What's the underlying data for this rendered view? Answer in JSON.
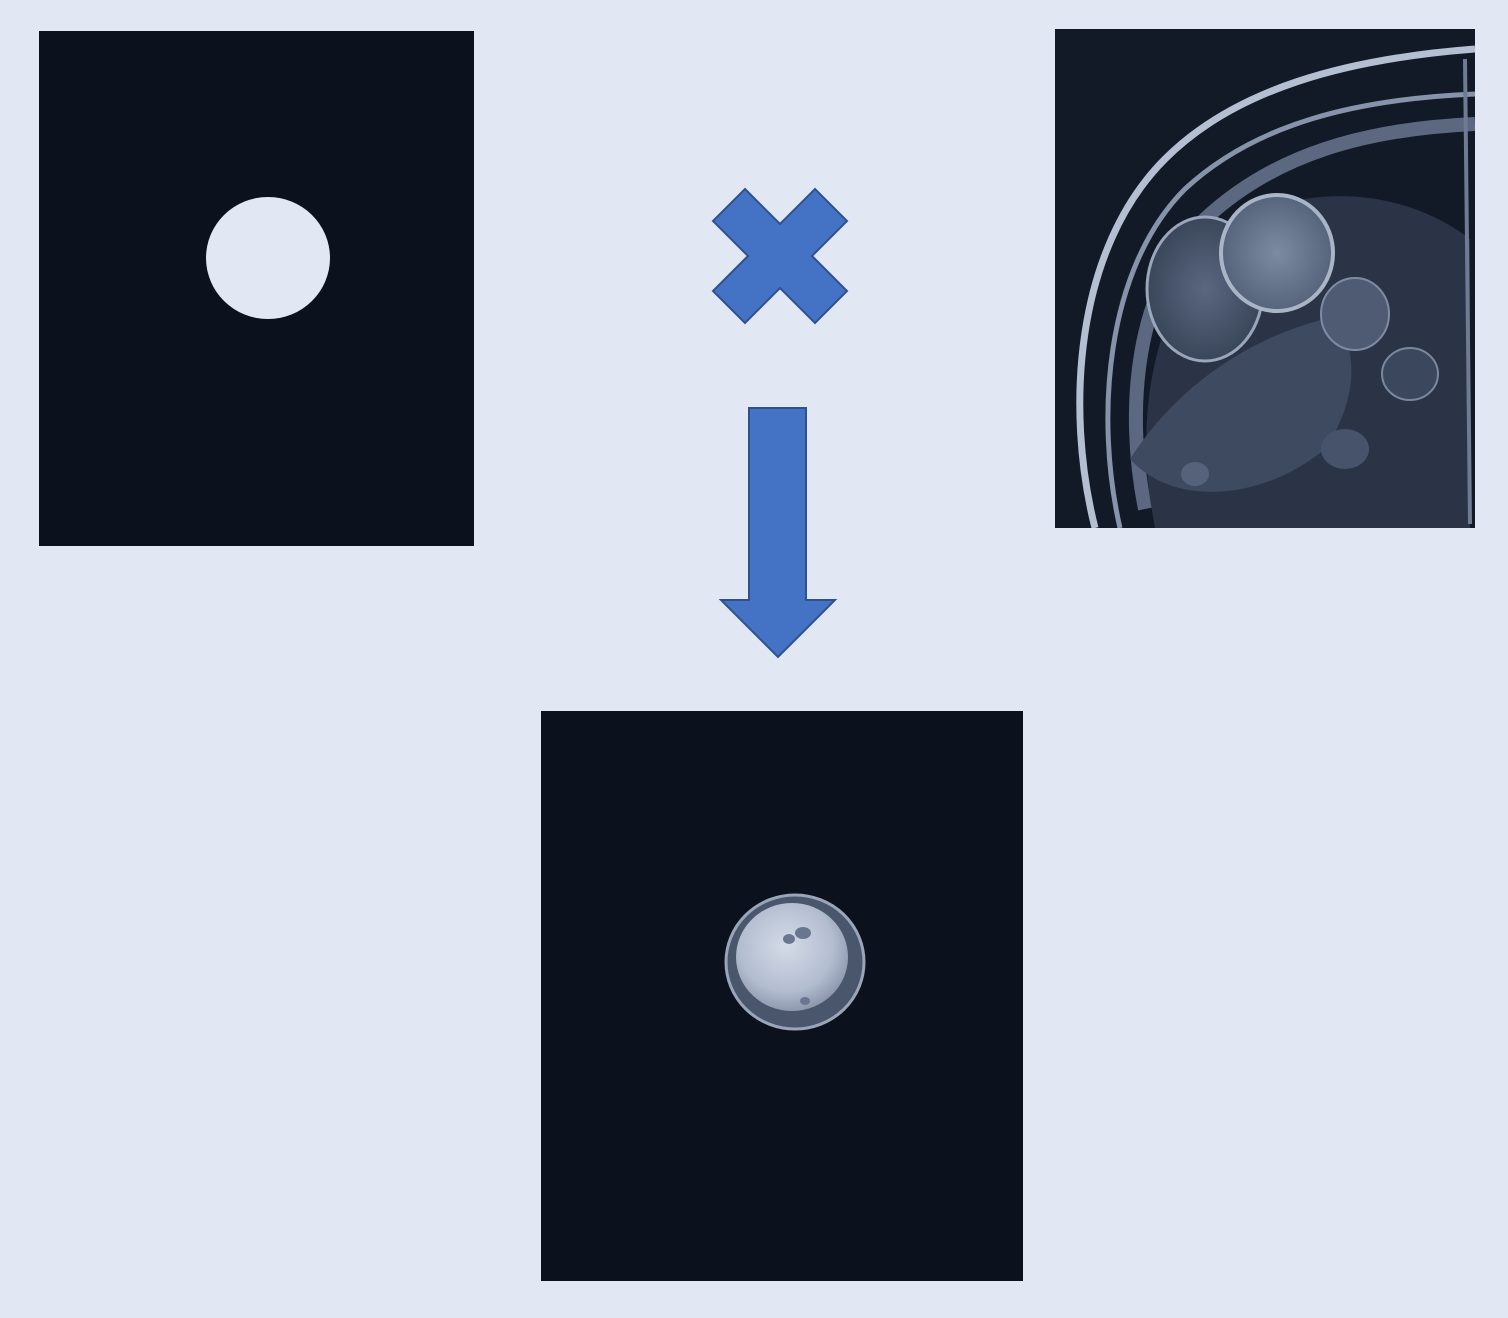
{
  "diagram": {
    "nodes": [
      {
        "id": "mask",
        "kind": "image",
        "icon": "binary-circle-mask"
      },
      {
        "id": "mri",
        "kind": "image",
        "icon": "cardiac-mri-short-axis"
      },
      {
        "id": "result",
        "kind": "image",
        "icon": "masked-left-ventricle"
      }
    ],
    "operators": [
      {
        "id": "multiply",
        "icon": "multiply-icon",
        "between": [
          "mask",
          "mri"
        ]
      },
      {
        "id": "down-arrow",
        "icon": "arrow-down-icon",
        "to": "result"
      }
    ]
  },
  "colors": {
    "background": "#e1e8f4",
    "panel": "#0b111d",
    "accent": "#4472c4",
    "accent_stroke": "#2f528f",
    "mask_fill": "#e1e8f4"
  }
}
